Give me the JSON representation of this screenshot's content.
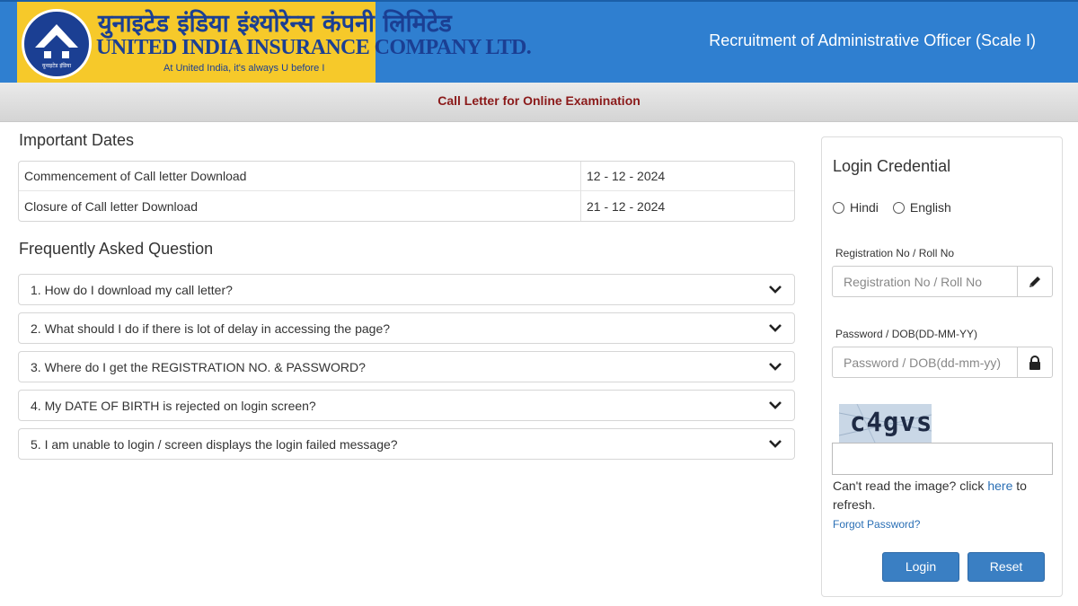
{
  "header": {
    "logo_hindi": "युनाइटेड इंडिया इंश्योरेन्स कंपनी लिमिटेड",
    "logo_english": "UNITED INDIA INSURANCE COMPANY LTD.",
    "logo_tagline": "At United India, it's always U before I",
    "title": "Recruitment of Administrative Officer (Scale I)",
    "colors": {
      "header_bg": "#2f7fd0",
      "logo_bg": "#f6c92a",
      "logo_text": "#1b3f93"
    }
  },
  "subbar": {
    "title": "Call Letter for Online Examination",
    "color": "#8b1a1a"
  },
  "important_dates": {
    "heading": "Important Dates",
    "rows": [
      {
        "label": "Commencement of Call letter Download",
        "value": "12 - 12 - 2024"
      },
      {
        "label": "Closure of Call letter Download",
        "value": "21 - 12 - 2024"
      }
    ]
  },
  "faq": {
    "heading": "Frequently Asked Question",
    "items": [
      {
        "question": "1. How do I download my call letter?",
        "icon": "chevron-down-icon"
      },
      {
        "question": "2. What should I do if there is lot of delay in accessing the page?",
        "icon": "chevron-down-icon"
      },
      {
        "question": "3. Where do I get the REGISTRATION NO. & PASSWORD?",
        "icon": "chevron-down-icon"
      },
      {
        "question": "4. My DATE OF BIRTH is rejected on login screen?",
        "icon": "chevron-down-icon"
      },
      {
        "question": "5. I am unable to login / screen displays the login failed message?",
        "icon": "chevron-down-icon"
      }
    ]
  },
  "login": {
    "title": "Login Credential",
    "language_options": [
      "Hindi",
      "English"
    ],
    "registration_label": "Registration No / Roll No",
    "registration_placeholder": "Registration No / Roll No",
    "registration_icon": "pencil-icon",
    "password_label": "Password / DOB(DD-MM-YY)",
    "password_placeholder": "Password / DOB(dd-mm-yy)",
    "password_icon": "lock-icon",
    "captcha_text": "c4gvs",
    "captcha_input_value": "",
    "cant_read_prefix": "Can't read the image? click ",
    "cant_read_link": "here",
    "cant_read_suffix": " to refresh.",
    "forgot_password": "Forgot Password?",
    "login_button": "Login",
    "reset_button": "Reset",
    "button_color": "#3a7fc3",
    "link_color": "#2a6fb5"
  }
}
